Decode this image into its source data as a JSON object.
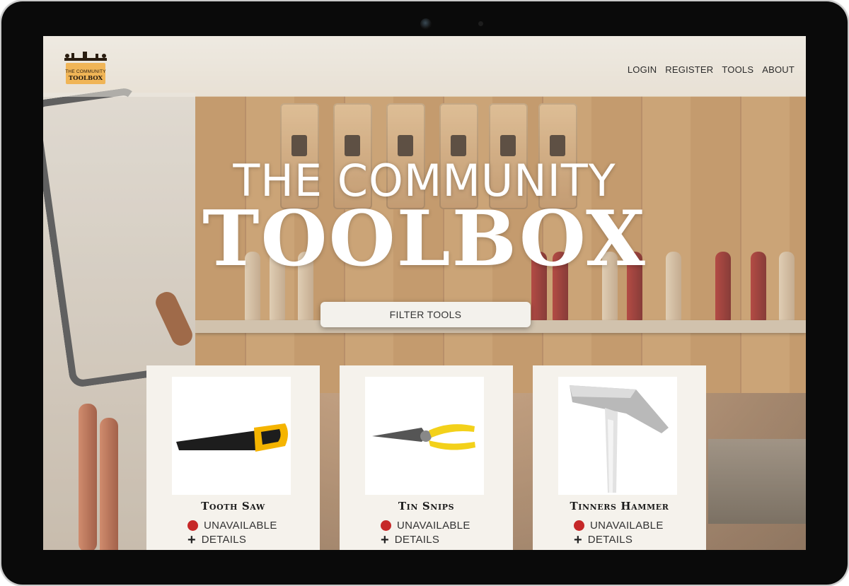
{
  "logo": {
    "line1": "THE COMMUNITY",
    "line2": "TOOLBOX"
  },
  "nav": {
    "items": [
      {
        "label": "LOGIN"
      },
      {
        "label": "REGISTER"
      },
      {
        "label": "TOOLS"
      },
      {
        "label": "ABOUT"
      }
    ]
  },
  "hero": {
    "title_line1": "THE COMMUNITY",
    "title_line2": "TOOLBOX",
    "filter_button": "FILTER TOOLS"
  },
  "tools": [
    {
      "name": "Tooth Saw",
      "status": "UNAVAILABLE",
      "details": "DETAILS",
      "icon": "hand-saw-image"
    },
    {
      "name": "Tin Snips",
      "status": "UNAVAILABLE",
      "details": "DETAILS",
      "icon": "tin-snips-image"
    },
    {
      "name": "Tinners Hammer",
      "status": "UNAVAILABLE",
      "details": "DETAILS",
      "icon": "hammer-image"
    }
  ],
  "colors": {
    "status_unavailable": "#c62828",
    "logo_box": "#f0b557"
  }
}
